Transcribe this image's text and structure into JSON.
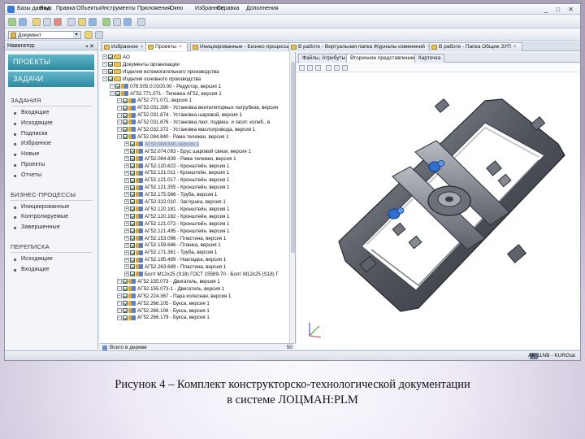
{
  "menu": [
    "Базы данных",
    "Вид",
    "Правка",
    "Объекты",
    "Инструменты",
    "Приложения",
    "Окно",
    "Избранное",
    "Справка",
    "Дополнения"
  ],
  "document_selector": "Документ",
  "navigator": {
    "title": "Навигатор",
    "buttons": [
      "ПРОЕКТЫ",
      "ЗАДАЧИ"
    ],
    "sections": [
      {
        "title": "ЗАДАНИЯ",
        "items": [
          "Входящие",
          "Исходящие",
          "Подписки",
          "Избранное",
          "Новые",
          "Проекты",
          "Отчеты"
        ]
      },
      {
        "title": "БИЗНЕС-ПРОЦЕССЫ",
        "items": [
          "Инициированные",
          "Контролируемые",
          "Завершенные"
        ]
      },
      {
        "title": "ПЕРЕПИСКА",
        "items": [
          "Исходящие",
          "Входящие"
        ]
      }
    ]
  },
  "tabs": [
    "Избранное",
    "Проекты",
    "Инициированные - Бизнес-процессы",
    "В работе - Виртуальная папка Журналы изменений",
    "В работе - Папка Общие ЗУП"
  ],
  "active_tab": "Проекты",
  "tree": [
    {
      "text": "АО",
      "level": 0,
      "folder": true
    },
    {
      "text": "Документы организации",
      "level": 0,
      "folder": true
    },
    {
      "text": "Изделия вспомогательного производства",
      "level": 0,
      "folder": true
    },
    {
      "text": "Изделия основного производства",
      "level": 0,
      "folder": true
    },
    {
      "text": "078.505.0.0100.00 - Редуктор, версия 1",
      "level": 1
    },
    {
      "text": "АГ52.771.071 - Тележка АГ52, версия 1",
      "level": 1
    },
    {
      "text": "АГ52.771.071, версия 1",
      "level": 2
    },
    {
      "text": "АГ52.031.390 - Установка вентиляторных патрубков, версия",
      "level": 2
    },
    {
      "text": "АГ52.031.874 - Установка шаровой, версия 1",
      "level": 2
    },
    {
      "text": "АГ52.031.876 - Установка люл. подвеш. и гасит. колеб., в",
      "level": 2
    },
    {
      "text": "АГ52.032.372 - Установка маслопровода, версия 1",
      "level": 2
    },
    {
      "text": "АГ52.084.840 - Рама тележки, версия 1",
      "level": 2
    },
    {
      "text": "АГ52.084.840, версия 1",
      "level": 3,
      "selected": true
    },
    {
      "text": "АГ52.074.093 - Брус шаровой связи, версия 1",
      "level": 3
    },
    {
      "text": "АГ52.084.839 - Рама тележки, версия 1",
      "level": 3
    },
    {
      "text": "АГ52.120.622 - Кронштейн, версия 1",
      "level": 3
    },
    {
      "text": "АГ52.121.011 - Кронштейн, версия 1",
      "level": 3
    },
    {
      "text": "АГ52.121.017 - Кронштейн, версия 1",
      "level": 3
    },
    {
      "text": "АГ52.121.355 - Кронштейн, версия 1",
      "level": 3
    },
    {
      "text": "АГ52.175.566 - Труба, версия 1",
      "level": 3
    },
    {
      "text": "АГ52.322.010 - Заглушка, версия 1",
      "level": 3
    },
    {
      "text": "АГ52.120.181 - Кронштейн, версия 1",
      "level": 3
    },
    {
      "text": "АГ52.120.182 - Кронштейн, версия 1",
      "level": 3
    },
    {
      "text": "АГ52.121.072 - Кронштейн, версия 1",
      "level": 3
    },
    {
      "text": "АГ52.121.495 - Кронштейн, версия 1",
      "level": 3
    },
    {
      "text": "АГ52.153.096 - Пластина, версия 1",
      "level": 3
    },
    {
      "text": "АГ52.159.686 - Планка, версия 1",
      "level": 3
    },
    {
      "text": "АГ52.171.361 - Труба, версия 1",
      "level": 3
    },
    {
      "text": "АГ52.195.499 - Накладка, версия 1",
      "level": 3
    },
    {
      "text": "АГ52.263.689 - Пластина, версия 1",
      "level": 3
    },
    {
      "text": "Болт М12х25 (S18) ГОСТ 15589-70 - Болт М12х25 (S18) Г",
      "level": 3
    },
    {
      "text": "АГ52.155.073 - Двигатель, версия 1",
      "level": 2
    },
    {
      "text": "АГ52.155.073-1 - Двигатель, версия 1",
      "level": 2
    },
    {
      "text": "АГ52.224.367 - Пара колесная, версия 1",
      "level": 2
    },
    {
      "text": "АГ52.266.105 - Букса, версия 1",
      "level": 2
    },
    {
      "text": "АГ52.266.106 - Букса, версия 1",
      "level": 2
    },
    {
      "text": "АГ52.266.179 - Букса, версия 1",
      "level": 2
    }
  ],
  "tree_footer": {
    "label": "Всего в дереве",
    "count": "50"
  },
  "right_tabs": [
    "Файлы, Атрибуты",
    "Вторичное представление",
    "Карточка"
  ],
  "active_right_tab": "Вторичное представление",
  "status_user": "AK-11NB - KURG\\al",
  "caption": [
    "Рисунок 4 – Комплект конструкторско-технологической документации",
    "в системе ЛОЦМАН:PLM"
  ]
}
